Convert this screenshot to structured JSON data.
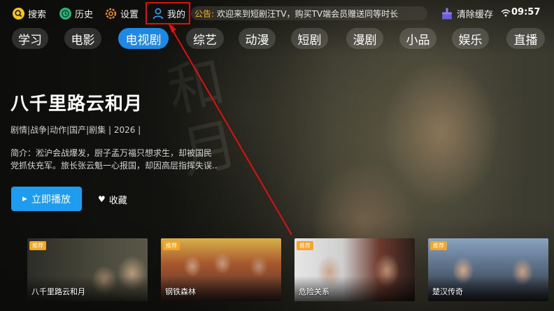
{
  "topbar": {
    "search_label": "搜索",
    "history_label": "历史",
    "settings_label": "设置",
    "mine_label": "我的",
    "notice_label": "公告:",
    "notice_text": "欢迎来到短剧汪TV，购买TV端会员赠送同等时长",
    "clear_cache_label": "清除缓存",
    "time": "09:57"
  },
  "tabs": [
    "学习",
    "电影",
    "电视剧",
    "综艺",
    "动漫",
    "短剧",
    "漫剧",
    "小品",
    "娱乐",
    "直播"
  ],
  "active_tab": "电视剧",
  "hero": {
    "title": "八千里路云和月",
    "meta": "剧情|战争|动作|国产|剧集 | 2026 |",
    "desc_line1": "简介：淞沪会战爆发，厨子孟万福只想求生，却被国民",
    "desc_line2": "党抓伕充军。旅长张云魁一心报国，却因高层指挥失误..",
    "play_label": "立即播放",
    "favorite_label": "收藏"
  },
  "recommend": [
    {
      "badge": "推荐",
      "name": "八千里路云和月"
    },
    {
      "badge": "推荐",
      "name": "钢铁森林"
    },
    {
      "badge": "推荐",
      "name": "危险关系"
    },
    {
      "badge": "推荐",
      "name": "楚汉传奇"
    }
  ],
  "colors": {
    "accent_blue": "#1e88e5",
    "play_blue": "#1e9cf0",
    "notice_orange": "#f5b324",
    "badge_orange": "#f5a623",
    "highlight_red": "#e01010"
  }
}
